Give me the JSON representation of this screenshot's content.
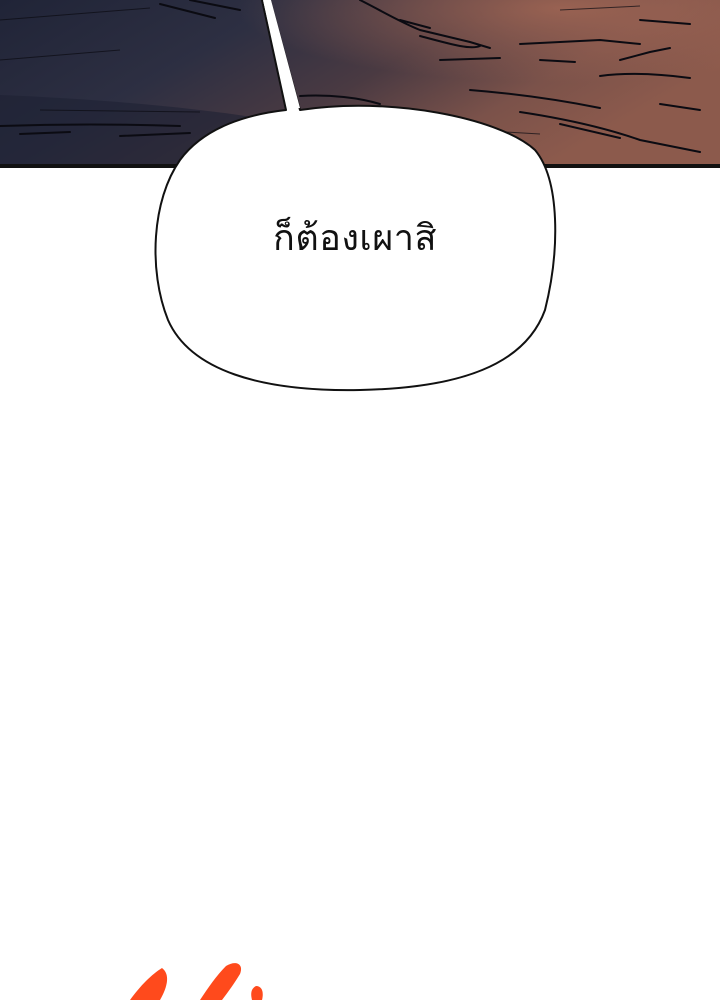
{
  "panel": {
    "dialogue": "ก็ต้องเผาสิ"
  },
  "colors": {
    "panel_dark": "#2a2d3e",
    "panel_warm": "#7a4f48",
    "panel_border": "#111111",
    "bubble_fill": "#ffffff",
    "accent_orange": "#ff4a1c"
  }
}
